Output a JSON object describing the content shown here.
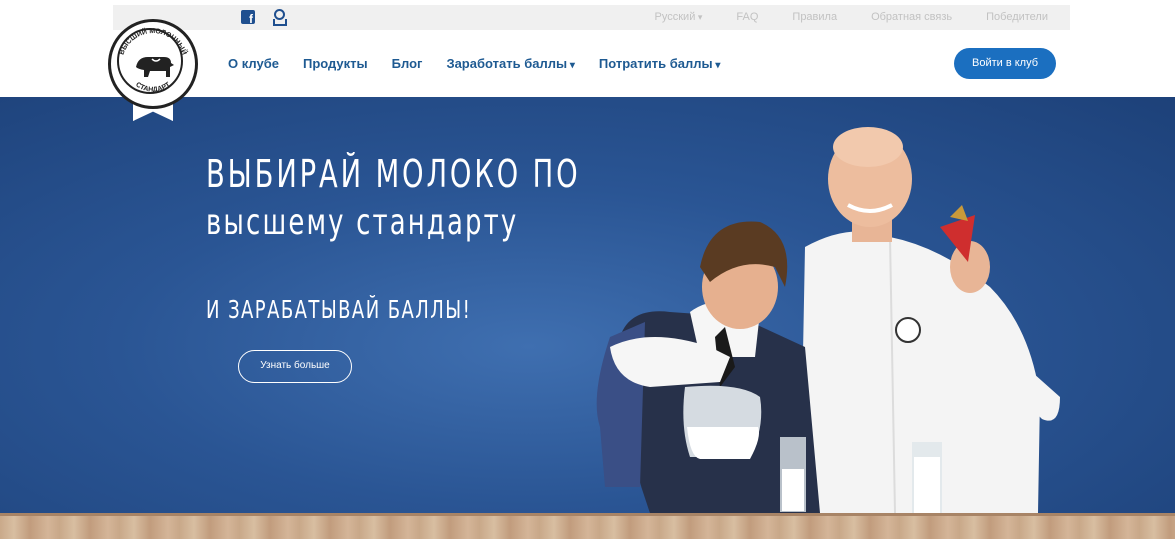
{
  "topbar": {
    "language": "Русский",
    "links": [
      "FAQ",
      "Правила",
      "Обратная связь",
      "Победители"
    ]
  },
  "social": {
    "icons": [
      "facebook-icon",
      "odnoklassniki-icon"
    ]
  },
  "logo": {
    "text_top": "ВЫСШИЙ МОЛОЧНЫЙ",
    "text_bottom": "СТАНДАРТ"
  },
  "nav": {
    "items": [
      "О клубе",
      "Продукты",
      "Блог",
      "Заработать баллы",
      "Потратить баллы"
    ],
    "login_label": "Войти в клуб"
  },
  "hero": {
    "headline_1": "ВЫБИРАЙ МОЛОКО ПО",
    "headline_2": "высшему стандарту",
    "headline_3": "И ЗАРАБАТЫВАЙ БАЛЛЫ!",
    "cta_label": "Узнать больше"
  },
  "colors": {
    "nav_text": "#1e5a92",
    "button_blue": "#1b6fc0",
    "hero_blue": "#2a5594"
  }
}
